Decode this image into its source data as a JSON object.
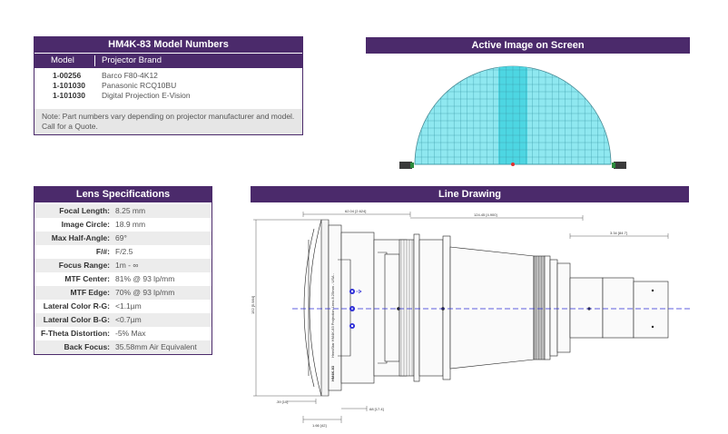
{
  "model_numbers": {
    "title": "HM4K-83 Model Numbers",
    "col_model": "Model",
    "col_brand": "Projector Brand",
    "rows": [
      {
        "model": "1-00256",
        "brand": "Barco F80-4K12"
      },
      {
        "model": "1-101030",
        "brand": "Panasonic RCQ10BU"
      },
      {
        "model": "1-101030",
        "brand": "Digital Projection E-Vision"
      }
    ],
    "note_line1": "Note: Part numbers vary depending on projector manufacturer and model.",
    "note_line2": "Call for a Quote."
  },
  "lens_specs": {
    "title": "Lens Specifications",
    "rows": [
      {
        "label": "Focal Length:",
        "value": "8.25 mm"
      },
      {
        "label": "Image Circle:",
        "value": "18.9 mm"
      },
      {
        "label": "Max Half-Angle:",
        "value": "69°"
      },
      {
        "label": "F/#:",
        "value": "F/2.5"
      },
      {
        "label": "Focus Range:",
        "value": "1m - ∞"
      },
      {
        "label": "MTF Center:",
        "value": "81% @ 93 lp/mm"
      },
      {
        "label": "MTF Edge:",
        "value": "70% @ 93 lp/mm"
      },
      {
        "label": "Lateral Color R-G:",
        "value": "<1.1µm"
      },
      {
        "label": "Lateral Color B-G:",
        "value": "<0.7µm"
      },
      {
        "label": "F-Theta Distortion:",
        "value": "-5% Max"
      },
      {
        "label": "Back Focus:",
        "value": "35.58mm Air Equivalent"
      }
    ]
  },
  "active_image": {
    "title": "Active Image on Screen",
    "colors": {
      "dome_fill": "#8fe8f0",
      "dome_band": "#4dd6e2",
      "grid": "#3a9aa8"
    }
  },
  "line_drawing": {
    "title": "Line Drawing",
    "dimensions": {
      "d1": "62.04 [2.624]",
      "d2": "124.45 [4.900]",
      "d3": "3.34 [84.7]",
      "d4": "152 [5.984]",
      "d5": ".39 [10]",
      "d6": ".68 [17.4]",
      "d7": "1.66 [42]"
    },
    "engraving": "HemiStar HM4K-83 Projection Lens 8.25mm - USA -",
    "engraving_mark": "HM4K-83"
  },
  "colors": {
    "brand": "#4b2a6b",
    "axis": "#2b2bd6"
  }
}
